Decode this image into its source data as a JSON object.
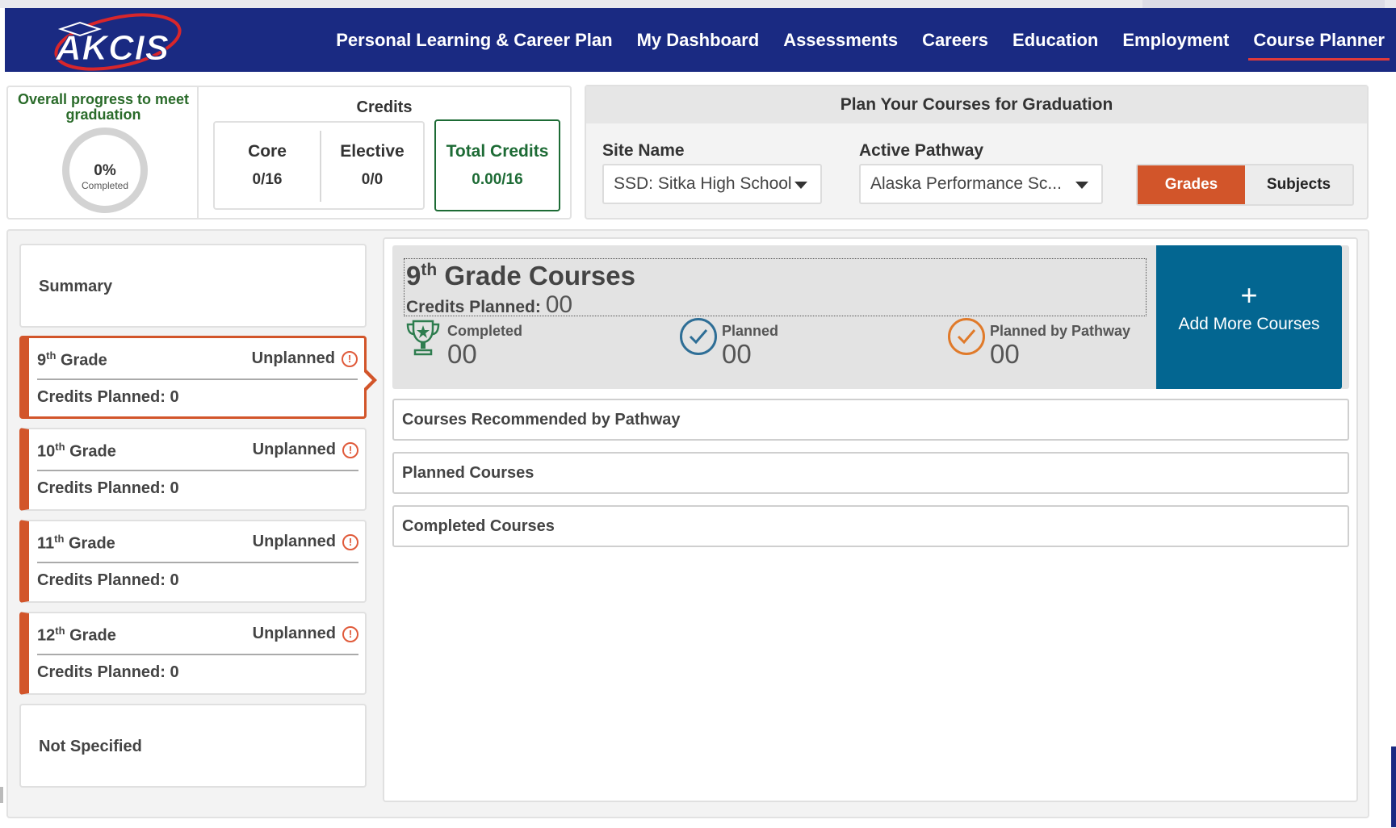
{
  "header": {
    "logo_text": "AKCIS",
    "nav": [
      {
        "label": "Personal Learning & Career Plan",
        "active": false
      },
      {
        "label": "My Dashboard",
        "active": false
      },
      {
        "label": "Assessments",
        "active": false
      },
      {
        "label": "Careers",
        "active": false
      },
      {
        "label": "Education",
        "active": false
      },
      {
        "label": "Employment",
        "active": false
      },
      {
        "label": "Course Planner",
        "active": true
      }
    ]
  },
  "progress": {
    "title": "Overall progress to meet graduation",
    "percent_text": "0%",
    "percent_label": "Completed",
    "percent_value": 0
  },
  "credits": {
    "title": "Credits",
    "core_label": "Core",
    "core_value": "0/16",
    "elective_label": "Elective",
    "elective_value": "0/0",
    "total_label": "Total Credits",
    "total_value": "0.00/16"
  },
  "plan": {
    "title": "Plan Your Courses for Graduation",
    "site_label": "Site Name",
    "site_value": "SSD: Sitka High School",
    "pathway_label": "Active Pathway",
    "pathway_value": "Alaska Performance Sc...",
    "toggle": [
      {
        "label": "Grades",
        "selected": true
      },
      {
        "label": "Subjects",
        "selected": false
      }
    ]
  },
  "sidebar": {
    "summary_label": "Summary",
    "grades": [
      {
        "num": "9",
        "sup": "th",
        "suffix": "Grade",
        "status": "Unplanned",
        "credits": "Credits Planned: 0",
        "active": true
      },
      {
        "num": "10",
        "sup": "th",
        "suffix": "Grade",
        "status": "Unplanned",
        "credits": "Credits Planned: 0",
        "active": false
      },
      {
        "num": "11",
        "sup": "th",
        "suffix": "Grade",
        "status": "Unplanned",
        "credits": "Credits Planned: 0",
        "active": false
      },
      {
        "num": "12",
        "sup": "th",
        "suffix": "Grade",
        "status": "Unplanned",
        "credits": "Credits Planned: 0",
        "active": false
      }
    ],
    "not_specified_label": "Not Specified"
  },
  "grade_detail": {
    "num": "9",
    "sup": "th",
    "title_suffix": "Grade Courses",
    "credits_planned_label": "Credits Planned:",
    "credits_planned_value": "00",
    "stats": [
      {
        "label": "Completed",
        "value": "00",
        "icon": "trophy-icon"
      },
      {
        "label": "Planned",
        "value": "00",
        "icon": "check-circle-icon"
      },
      {
        "label": "Planned by Pathway",
        "value": "00",
        "icon": "check-circle-orange-icon"
      }
    ],
    "add_button_icon": "+",
    "add_button_label": "Add More Courses"
  },
  "sections": [
    {
      "label": "Courses Recommended by Pathway"
    },
    {
      "label": "Planned Courses"
    },
    {
      "label": "Completed Courses"
    }
  ],
  "colors": {
    "header_bg": "#1a2a82",
    "accent_orange": "#d2552a",
    "total_green": "#1d6b35",
    "add_button_blue": "#036691"
  }
}
